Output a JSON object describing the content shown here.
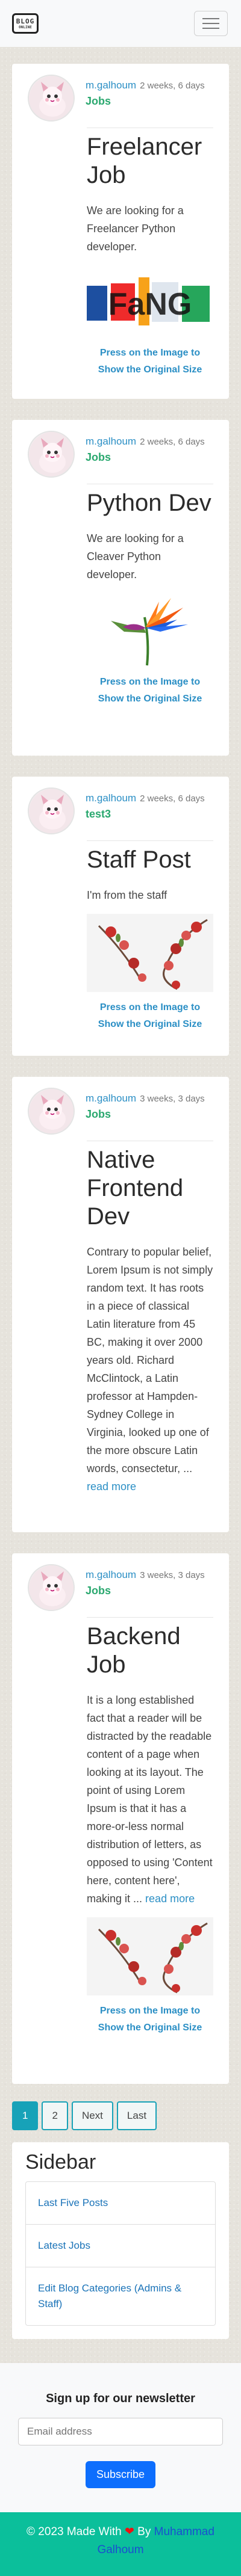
{
  "logo": {
    "line1": "BLOG",
    "line2": "ONLINE"
  },
  "posts": [
    {
      "author": "m.galhoum",
      "date": "2 weeks, 6 days",
      "category": "Jobs",
      "title": "Freelancer Job",
      "content": "We are looking for a Freelancer Python developer.",
      "image_kind": "text-image",
      "image_note": "Press on the Image to Show the Original Size"
    },
    {
      "author": "m.galhoum",
      "date": "2 weeks, 6 days",
      "category": "Jobs",
      "title": "Python Dev",
      "content": "We are looking for a Cleaver Python developer.",
      "image_kind": "flower-bird",
      "image_note": "Press on the Image to Show the Original Size"
    },
    {
      "author": "m.galhoum",
      "date": "2 weeks, 6 days",
      "category": "test3",
      "title": "Staff Post",
      "content": "I'm from the staff",
      "image_kind": "blossom",
      "image_note": "Press on the Image to Show the Original Size"
    },
    {
      "author": "m.galhoum",
      "date": "3 weeks, 3 days",
      "category": "Jobs",
      "title": "Native Frontend Dev",
      "content": "Contrary to popular belief, Lorem Ipsum is not simply random text. It has roots in a piece of classical Latin literature from 45 BC, making it over 2000 years old. Richard McClintock, a Latin professor at Hampden-Sydney College in Virginia, looked up one of the more obscure Latin words, consectetur, ...",
      "read_more": "read more"
    },
    {
      "author": "m.galhoum",
      "date": "3 weeks, 3 days",
      "category": "Jobs",
      "title": "Backend Job",
      "content": "It is a long established fact that a reader will be distracted by the readable content of a page when looking at its layout. The point of using Lorem Ipsum is that it has a more-or-less normal distribution of letters, as opposed to using 'Content here, content here', making it ...",
      "read_more": "read more",
      "image_kind": "blossom",
      "image_note": "Press on the Image to Show the Original Size"
    }
  ],
  "image_text": "FaNG",
  "pagination": {
    "p1": "1",
    "p2": "2",
    "next": "Next",
    "last": "Last"
  },
  "sidebar": {
    "title": "Sidebar",
    "items": [
      "Last Five Posts",
      "Latest Jobs",
      "Edit Blog Categories (Admins & Staff)"
    ]
  },
  "newsletter": {
    "title": "Sign up for our newsletter",
    "placeholder": "Email address",
    "button": "Subscribe"
  },
  "footer": {
    "text": "© 2023 Made With",
    "by": "By",
    "author": "Muhammad Galhoum"
  },
  "colors": {
    "accent": "#17a2b8",
    "link": "#2b8fc5",
    "category": "#2aa86f",
    "footer": "#0bbf9b",
    "button": "#0d6efd"
  }
}
